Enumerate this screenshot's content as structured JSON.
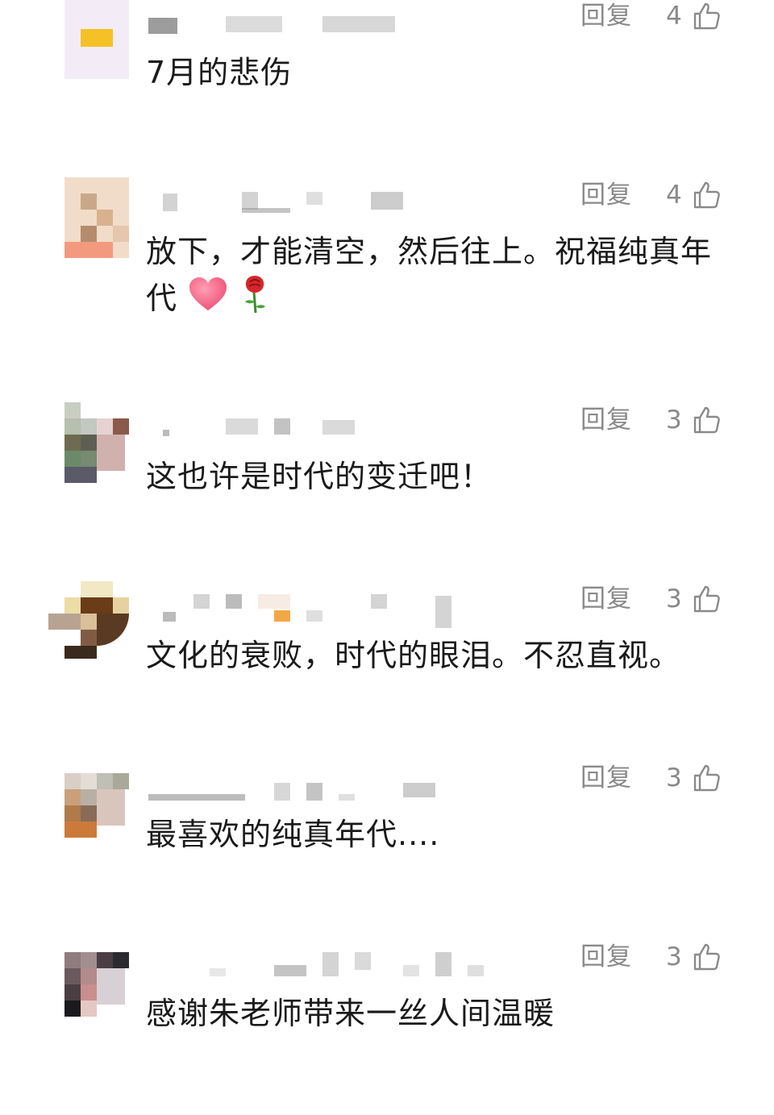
{
  "comments": [
    {
      "reply_label": "回复",
      "likes": "4",
      "text": "7月的悲伤",
      "emoji": []
    },
    {
      "reply_label": "回复",
      "likes": "4",
      "text": "放下，才能清空，然后往上。祝福纯真年代",
      "emoji": [
        "heart-icon",
        "rose-icon"
      ]
    },
    {
      "reply_label": "回复",
      "likes": "3",
      "text": "这也许是时代的变迁吧！",
      "emoji": []
    },
    {
      "reply_label": "回复",
      "likes": "3",
      "text": "文化的衰败，时代的眼泪。不忍直视。",
      "emoji": []
    },
    {
      "reply_label": "回复",
      "likes": "3",
      "text": "最喜欢的纯真年代....",
      "emoji": []
    },
    {
      "reply_label": "回复",
      "likes": "3",
      "text": "感谢朱老师带来一丝人间温暖",
      "emoji": []
    }
  ],
  "colors": {
    "meta_text": "#8a8a8a",
    "body_text": "#1a1a1a",
    "heart": "#f2587d",
    "rose": "#d6262c"
  }
}
